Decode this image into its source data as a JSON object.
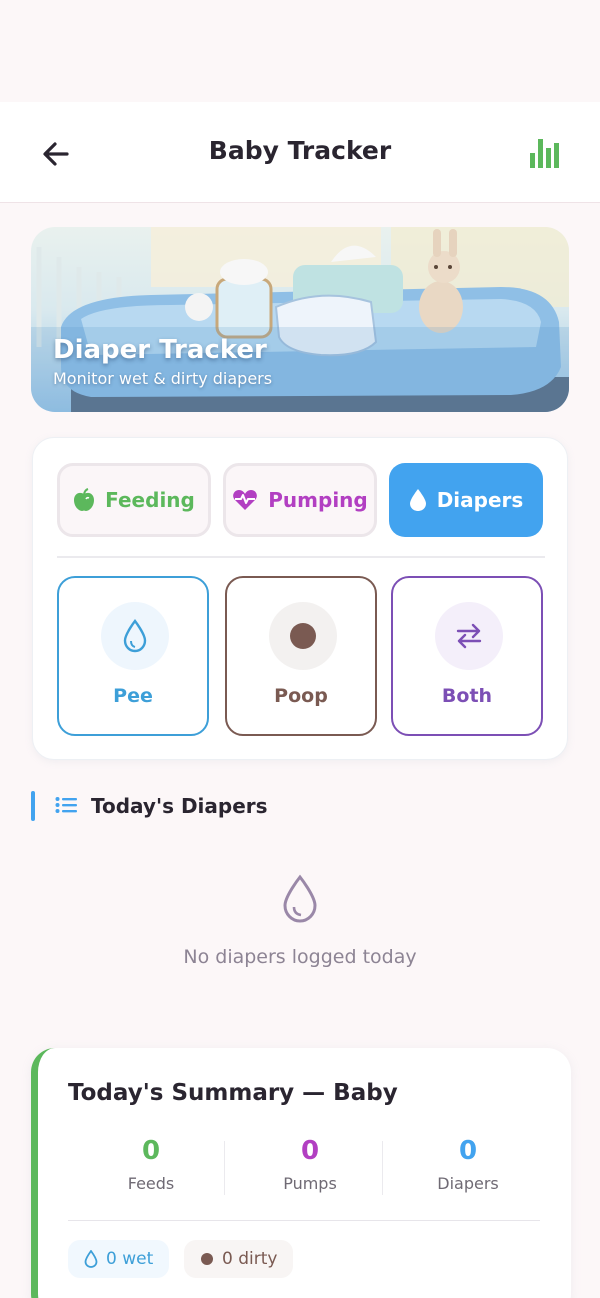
{
  "header": {
    "title": "Baby Tracker",
    "back_icon": "arrow-left-icon",
    "stats_icon": "bar-chart-icon"
  },
  "hero": {
    "title": "Diaper Tracker",
    "subtitle": "Monitor wet & dirty diapers"
  },
  "tabs": [
    {
      "label": "Feeding",
      "icon": "apple-icon",
      "color": "#5cb85c",
      "active": false
    },
    {
      "label": "Pumping",
      "icon": "heart-pulse-icon",
      "color": "#b23fc2",
      "active": false
    },
    {
      "label": "Diapers",
      "icon": "drop-icon",
      "color": "#42a3ef",
      "active": true
    }
  ],
  "diaper_types": [
    {
      "label": "Pee",
      "icon": "drop-icon",
      "color": "#3d9fd8"
    },
    {
      "label": "Poop",
      "icon": "dot-icon",
      "color": "#7a5a52"
    },
    {
      "label": "Both",
      "icon": "swap-arrows-icon",
      "color": "#7c4fb5"
    }
  ],
  "list": {
    "title": "Today's Diapers",
    "empty_text": "No diapers logged today"
  },
  "summary": {
    "title": "Today's Summary — Baby",
    "stats": [
      {
        "value": "0",
        "label": "Feeds",
        "color": "#5cb85c"
      },
      {
        "value": "0",
        "label": "Pumps",
        "color": "#b23fc2"
      },
      {
        "value": "0",
        "label": "Diapers",
        "color": "#42a3ef"
      }
    ],
    "wet": "0 wet",
    "dirty": "0 dirty"
  }
}
